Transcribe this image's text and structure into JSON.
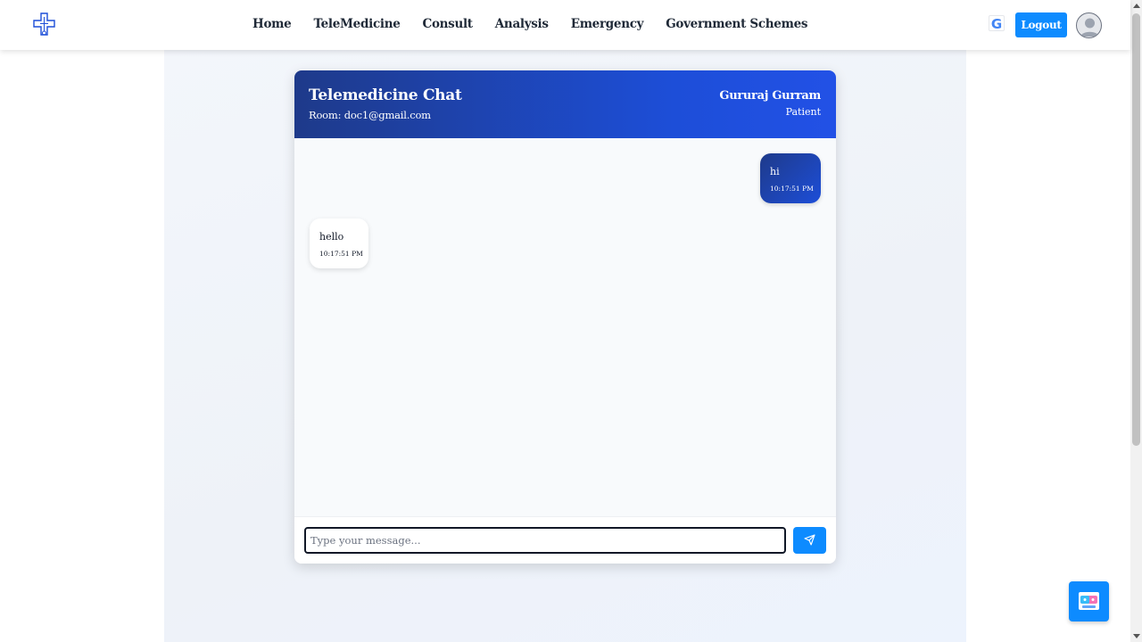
{
  "nav": {
    "logo_icon": "medical-cross-icon",
    "links": [
      "Home",
      "TeleMedicine",
      "Consult",
      "Analysis",
      "Emergency",
      "Government Schemes"
    ],
    "google_icon": "google-icon",
    "google_glyph": "G",
    "logout_label": "Logout",
    "avatar_icon": "user-avatar-icon"
  },
  "chat": {
    "title": "Telemedicine Chat",
    "room": "Room: doc1@gmail.com",
    "user_name": "Gururaj Gurram",
    "user_role": "Patient",
    "messages": [
      {
        "direction": "out",
        "text": "hi",
        "time": "10:17:51 PM"
      },
      {
        "direction": "in",
        "text": "hello",
        "time": "10:17:51 PM"
      }
    ],
    "input_placeholder": "Type your message...",
    "send_icon": "send-icon"
  },
  "chatbot_icon": "chatbot-icon",
  "colors": {
    "accent": "#0d8bff",
    "header_gradient_start": "#1e3a8a",
    "header_gradient_end": "#1d4ed8"
  }
}
